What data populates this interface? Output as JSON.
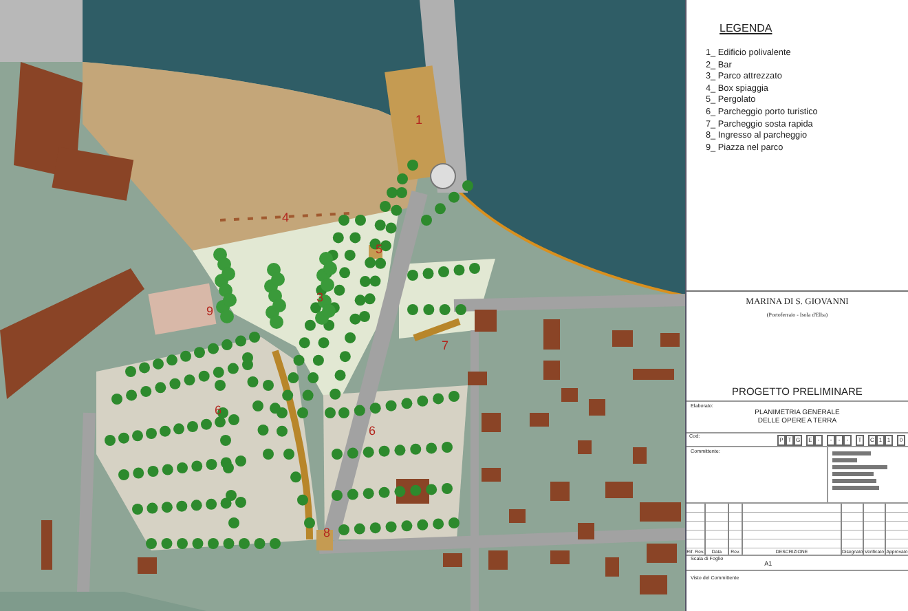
{
  "map": {
    "labels": [
      {
        "text": "1"
      },
      {
        "text": "4"
      },
      {
        "text": "5"
      },
      {
        "text": "3"
      },
      {
        "text": "9"
      },
      {
        "text": "7"
      },
      {
        "text": "6"
      },
      {
        "text": "6"
      },
      {
        "text": "8"
      }
    ]
  },
  "legend": {
    "title": "LEGENDA",
    "items": [
      "1_ Edificio polivalente",
      "2_ Bar",
      "3_ Parco attrezzato",
      "4_ Box spiaggia",
      "5_ Pergolato",
      "6_ Parcheggio porto turistico",
      "7_ Parcheggio sosta rapida",
      "8_ Ingresso al parcheggio",
      "9_ Piazza nel parco"
    ]
  },
  "title_block": {
    "project": "MARINA DI S. GIOVANNI",
    "location": "(Portoferraio - Isola d'Elba)",
    "phase": "PROGETTO PRELIMINARE",
    "drawing_label": "Elaborato:",
    "drawing_title": [
      "PLANIMETRIA GENERALE",
      "DELLE OPERE A TERRA"
    ],
    "code_label": "Cod:",
    "code": [
      [
        "P",
        "T",
        "G"
      ],
      [
        "E",
        "-"
      ],
      [
        "-",
        "-",
        "-"
      ],
      [
        "T"
      ],
      [
        "C",
        "1",
        "1"
      ],
      [
        "0"
      ]
    ],
    "client_label": "Committente:",
    "revision_headers": [
      "Rif. Rev.",
      "Data",
      "Rev.",
      "DESCRIZIONE",
      "Disegnato",
      "Verificato",
      "Approvato"
    ],
    "scale_label": "Scala di Foglio",
    "sheet": "A1",
    "approval_label": "Visto del Committente"
  }
}
